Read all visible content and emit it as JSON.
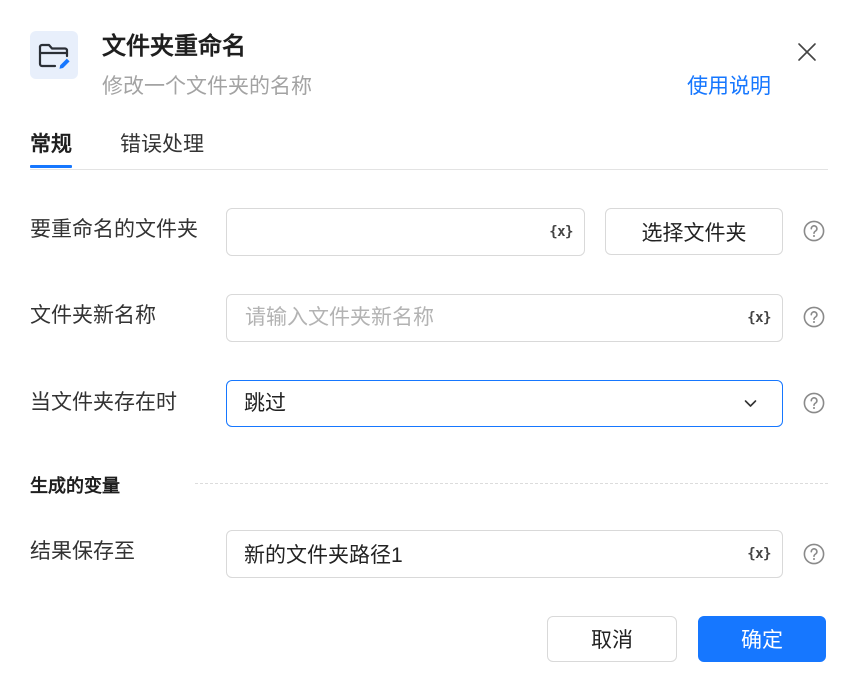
{
  "dialog": {
    "icon": "folder-edit-icon",
    "title": "文件夹重命名",
    "subtitle": "修改一个文件夹的名称",
    "help_link": "使用说明",
    "close_icon": "close-icon"
  },
  "tabs": [
    {
      "label": "常规",
      "active": true
    },
    {
      "label": "错误处理",
      "active": false
    }
  ],
  "form": {
    "folder_to_rename": {
      "label": "要重命名的文件夹",
      "value": "",
      "variable_token": "{x}",
      "select_button": "选择文件夹",
      "help_icon": "help-icon"
    },
    "new_name": {
      "label": "文件夹新名称",
      "placeholder": "请输入文件夹新名称",
      "variable_token": "{x}",
      "help_icon": "help-icon"
    },
    "when_exists": {
      "label": "当文件夹存在时",
      "selected": "跳过",
      "dropdown_icon": "chevron-down-icon",
      "help_icon": "help-icon"
    }
  },
  "output": {
    "section_title": "生成的变量",
    "save_to": {
      "label": "结果保存至",
      "value": "新的文件夹路径1",
      "variable_token": "{x}",
      "help_icon": "help-icon"
    }
  },
  "footer": {
    "cancel_label": "取消",
    "confirm_label": "确定"
  },
  "colors": {
    "accent": "#1677ff",
    "icon_background": "#e8effb",
    "border": "#d9d9d9",
    "text": "#333333",
    "muted_text": "#a3a3a3"
  }
}
